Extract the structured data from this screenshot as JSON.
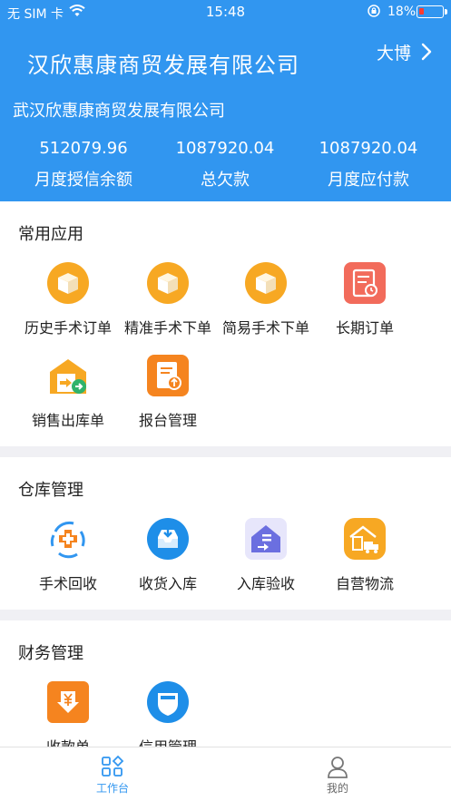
{
  "status_bar": {
    "carrier": "无 SIM 卡",
    "time": "15:48",
    "battery": "18%"
  },
  "header": {
    "title": "汉欣惠康商贸发展有限公司",
    "user_name": "大博",
    "subtitle": "武汉欣惠康商贸发展有限公司",
    "metrics": [
      {
        "value": "512079.96",
        "label": "月度授信余额"
      },
      {
        "value": "1087920.04",
        "label": "总欠款"
      },
      {
        "value": "1087920.04",
        "label": "月度应付款"
      }
    ]
  },
  "sections": {
    "common": {
      "title": "常用应用",
      "items": [
        {
          "label": "历史手术订单",
          "icon": "box-icon"
        },
        {
          "label": "精准手术下单",
          "icon": "box-icon"
        },
        {
          "label": "简易手术下单",
          "icon": "box-icon"
        },
        {
          "label": "长期订单",
          "icon": "document-icon"
        },
        {
          "label": "销售出库单",
          "icon": "warehouse-out-icon"
        },
        {
          "label": "报台管理",
          "icon": "upload-document-icon"
        }
      ]
    },
    "warehouse": {
      "title": "仓库管理",
      "items": [
        {
          "label": "手术回收",
          "icon": "recycle-cross-icon"
        },
        {
          "label": "收货入库",
          "icon": "inbox-icon"
        },
        {
          "label": "入库验收",
          "icon": "house-check-icon"
        },
        {
          "label": "自营物流",
          "icon": "logistics-icon"
        }
      ]
    },
    "finance": {
      "title": "财务管理",
      "items": [
        {
          "label": "收款单",
          "icon": "yuan-receipt-icon"
        },
        {
          "label": "信用管理",
          "icon": "shield-icon"
        }
      ]
    }
  },
  "tabbar": {
    "tabs": [
      {
        "label": "工作台",
        "active": true
      },
      {
        "label": "我的",
        "active": false
      }
    ]
  },
  "colors": {
    "primary": "#3196f0",
    "box_orange": "#f7a823",
    "doc_red": "#f26b5b",
    "orange": "#f5841f",
    "purple": "#6b6fe0"
  }
}
